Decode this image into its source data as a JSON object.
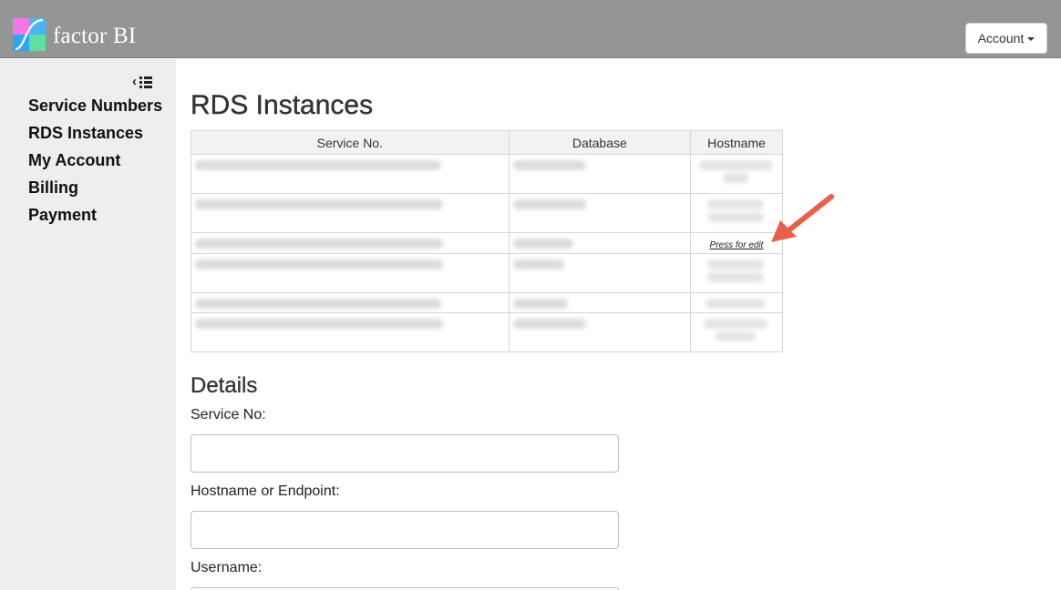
{
  "header": {
    "brand": "factor BI",
    "account_label": "Account"
  },
  "sidebar": {
    "items": [
      {
        "label": "Service Numbers"
      },
      {
        "label": "RDS Instances"
      },
      {
        "label": "My Account"
      },
      {
        "label": "Billing"
      },
      {
        "label": "Payment"
      }
    ]
  },
  "main": {
    "title": "RDS Instances",
    "table": {
      "columns": [
        "Service No.",
        "Database",
        "Hostname"
      ],
      "edit_link": "Press for edit"
    },
    "details": {
      "title": "Details",
      "fields": [
        {
          "label": "Service No:",
          "value": ""
        },
        {
          "label": "Hostname or Endpoint:",
          "value": ""
        },
        {
          "label": "Username:",
          "value": ""
        }
      ]
    }
  },
  "colors": {
    "topbar": "#959595",
    "sidebar": "#eeeeee",
    "annotation_arrow": "#e8604c"
  }
}
